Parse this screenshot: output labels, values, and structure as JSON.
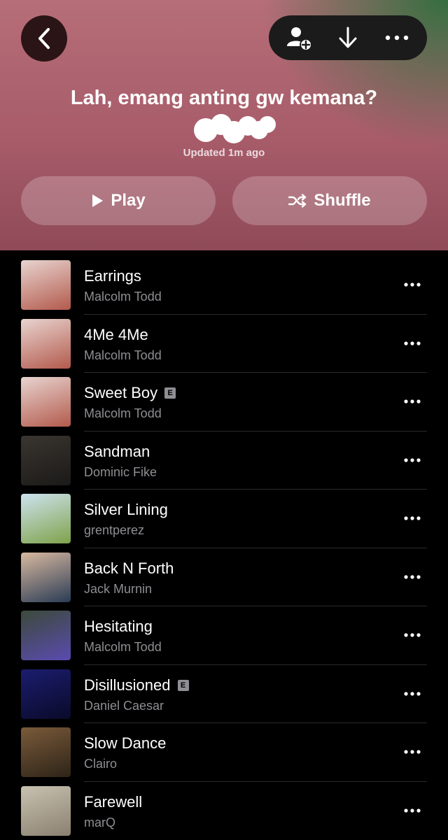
{
  "header": {
    "title": "Lah, emang anting gw kemana?",
    "updated": "Updated 1m ago",
    "play_label": "Play",
    "shuffle_label": "Shuffle",
    "icons": {
      "back": "chevron-left-icon",
      "add_person": "add-person-icon",
      "download": "download-arrow-icon",
      "more": "more-horizontal-icon"
    }
  },
  "songs": [
    {
      "title": "Earrings",
      "artist": "Malcolm Todd",
      "explicit": false,
      "art_colors": [
        "#e8d4d0",
        "#b35a4c"
      ]
    },
    {
      "title": "4Me 4Me",
      "artist": "Malcolm Todd",
      "explicit": false,
      "art_colors": [
        "#e8d4d0",
        "#b35a4c"
      ]
    },
    {
      "title": "Sweet Boy",
      "artist": "Malcolm Todd",
      "explicit": true,
      "explicit_label": "E",
      "art_colors": [
        "#e8d4d0",
        "#b35a4c"
      ]
    },
    {
      "title": "Sandman",
      "artist": "Dominic Fike",
      "explicit": false,
      "art_colors": [
        "#3a3530",
        "#1b1a18"
      ]
    },
    {
      "title": "Silver Lining",
      "artist": "grentperez",
      "explicit": false,
      "art_colors": [
        "#cde3ef",
        "#7fa24a"
      ]
    },
    {
      "title": "Back N Forth",
      "artist": "Jack Murnin",
      "explicit": false,
      "art_colors": [
        "#d9b9a0",
        "#2a3c55"
      ]
    },
    {
      "title": "Hesitating",
      "artist": "Malcolm Todd",
      "explicit": false,
      "art_colors": [
        "#3c4a3a",
        "#5a4bb0"
      ]
    },
    {
      "title": "Disillusioned",
      "artist": "Daniel Caesar",
      "explicit": true,
      "explicit_label": "E",
      "art_colors": [
        "#1b1d6e",
        "#0a0a2a"
      ]
    },
    {
      "title": "Slow Dance",
      "artist": "Clairo",
      "explicit": false,
      "art_colors": [
        "#7a5a3a",
        "#2e2418"
      ]
    },
    {
      "title": "Farewell",
      "artist": "marQ",
      "explicit": false,
      "art_colors": [
        "#c9c2b0",
        "#8a8070"
      ]
    }
  ]
}
